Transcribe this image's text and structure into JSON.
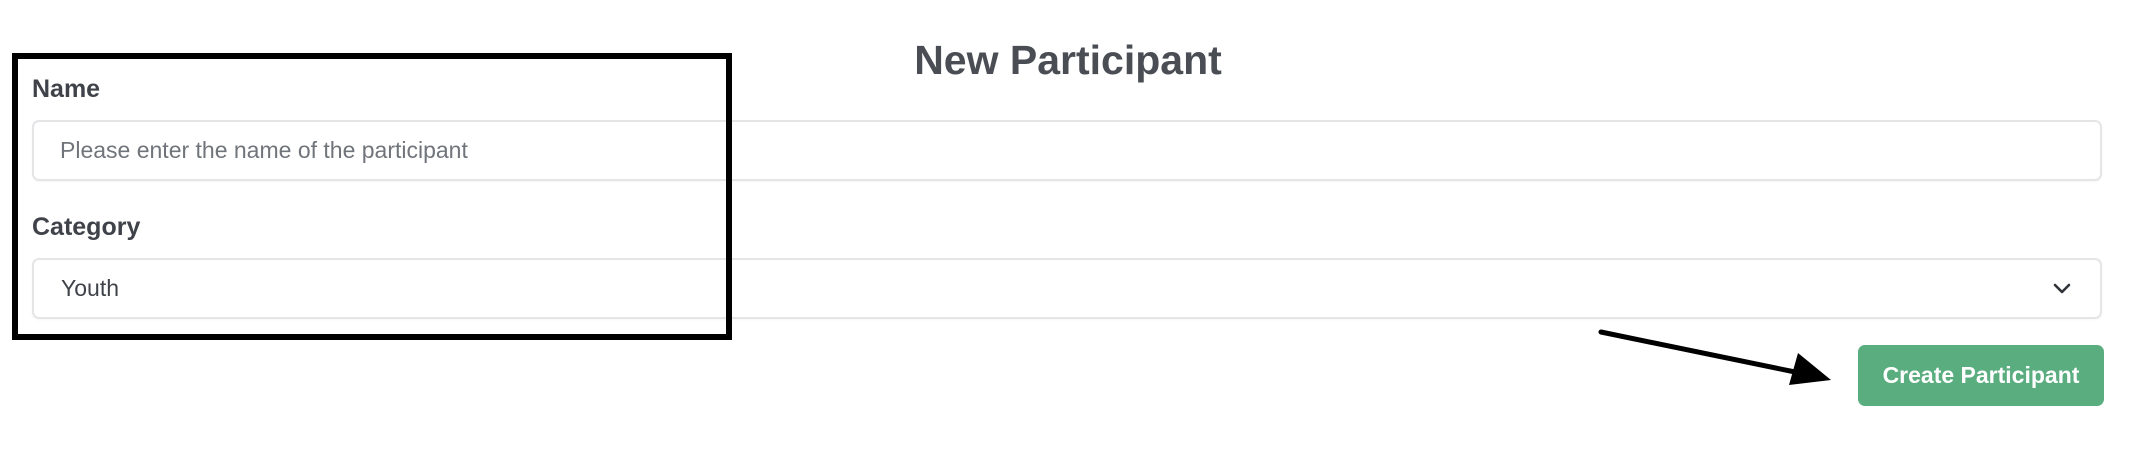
{
  "form": {
    "title": "New Participant",
    "name_label": "Name",
    "name_placeholder": "Please enter the name of the participant",
    "name_value": "",
    "category_label": "Category",
    "category_selected": "Youth",
    "submit_label": "Create Participant"
  },
  "icons": {
    "select_chevron": "chevron-down-icon"
  },
  "colors": {
    "primary_button": "#5aad7e",
    "text": "#3f4349",
    "input_border": "#e4e5e7",
    "annotation": "#000000"
  }
}
